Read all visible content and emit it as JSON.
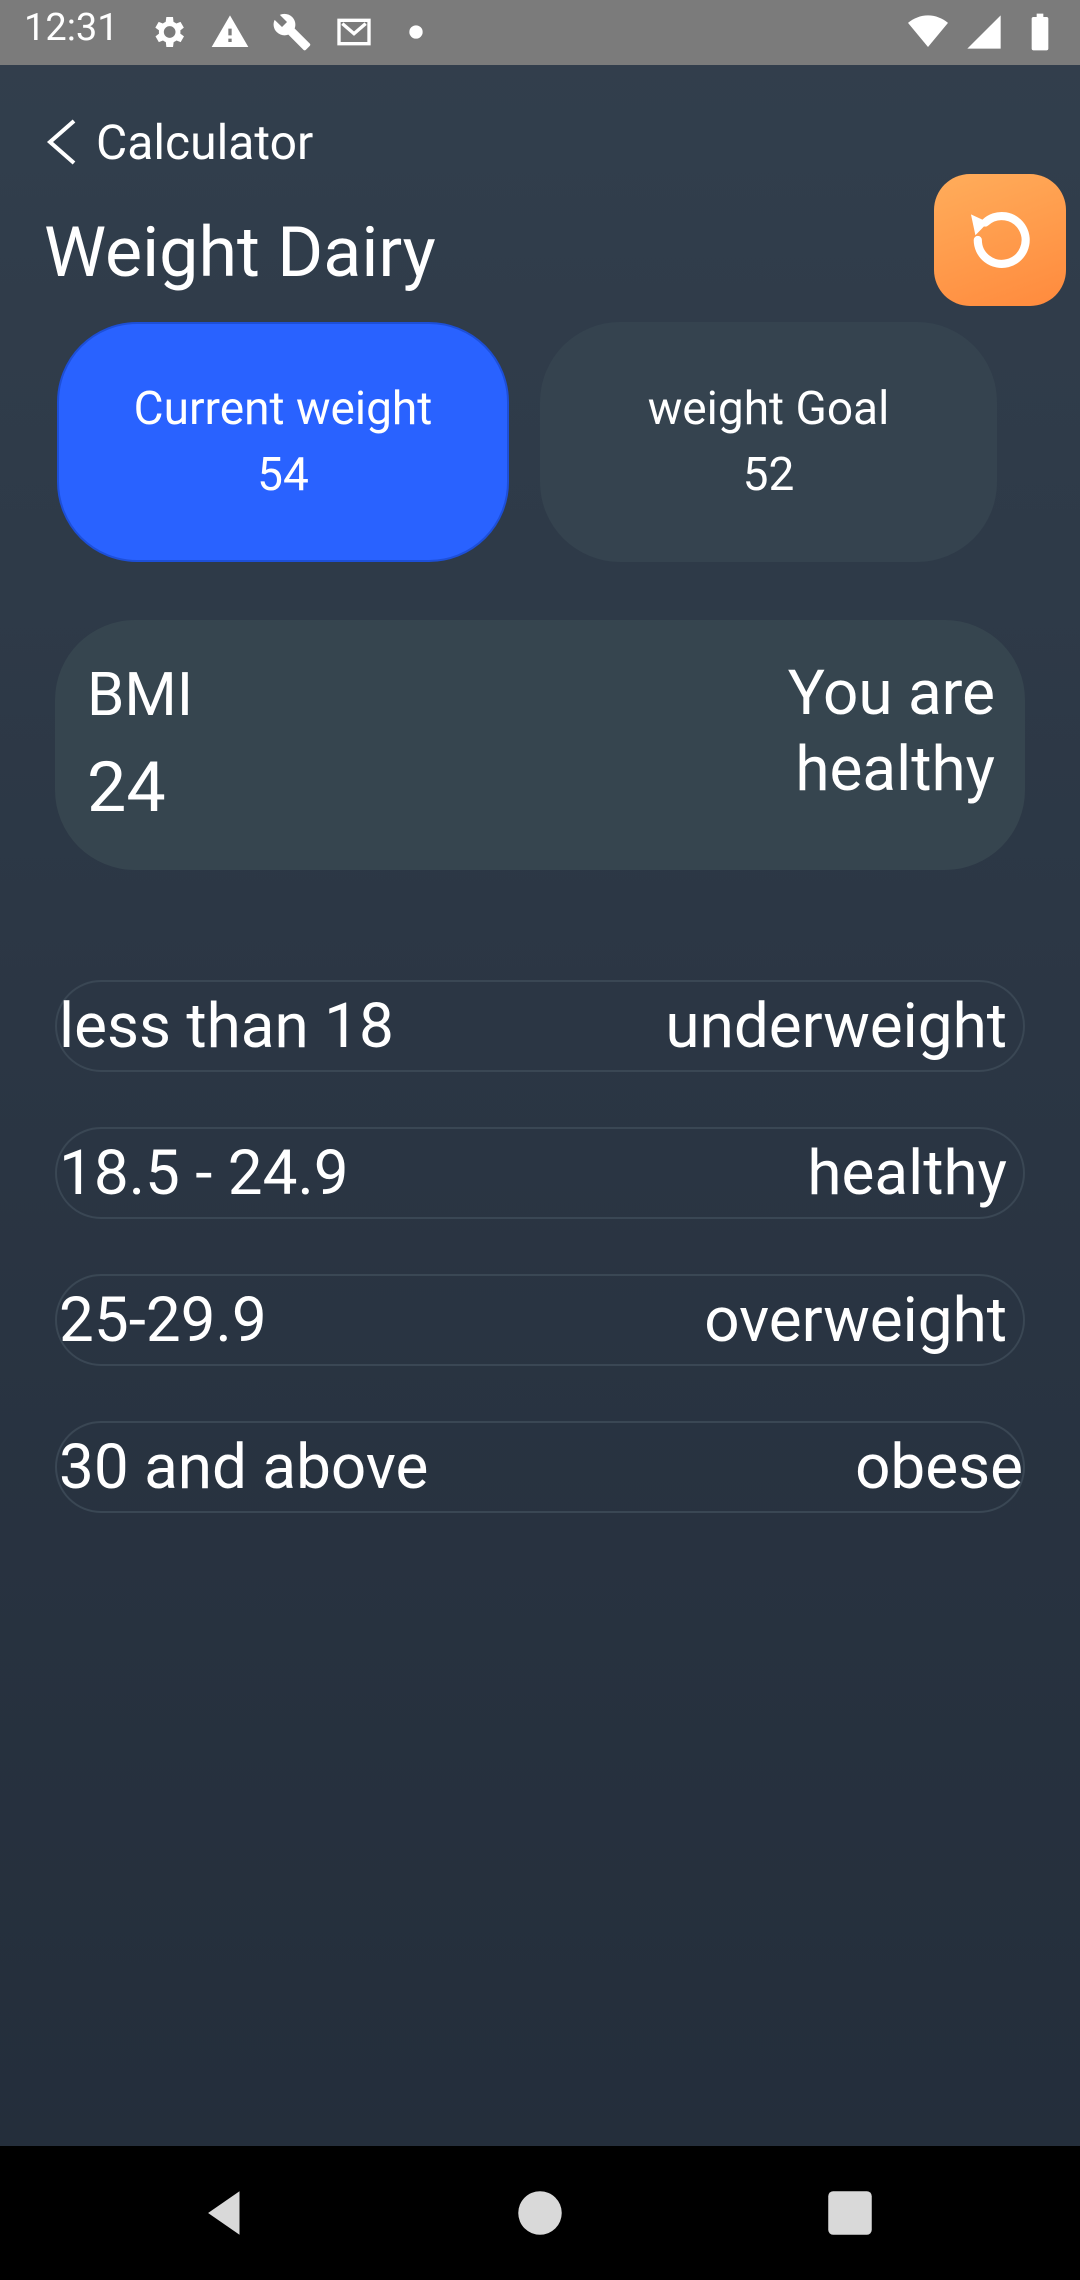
{
  "status_bar": {
    "time": "12:31",
    "left_icons": [
      "gear-icon",
      "warning-icon",
      "wrench-icon",
      "gmail-icon",
      "dot-icon"
    ],
    "right_icons": [
      "wifi-icon",
      "signal-icon",
      "battery-icon"
    ]
  },
  "header": {
    "back_label": "Calculator",
    "title": "Weight Dairy",
    "reset_icon": "refresh-icon",
    "accent_color": "#ff9447"
  },
  "weight": {
    "current": {
      "label": "Current weight",
      "value": "54",
      "color": "#2962ff"
    },
    "goal": {
      "label": "weight Goal",
      "value": "52"
    }
  },
  "bmi": {
    "label": "BMI",
    "value": "24",
    "status": "You are healthy"
  },
  "ranges": [
    {
      "range": "less than 18",
      "category": "underweight"
    },
    {
      "range": "18.5 - 24.9",
      "category": "healthy"
    },
    {
      "range": "25-29.9",
      "category": "overweight"
    },
    {
      "range": "30 and above",
      "category": "obese"
    }
  ],
  "nav_bar": {
    "buttons": [
      "back-nav-icon",
      "home-nav-icon",
      "recents-nav-icon"
    ]
  }
}
